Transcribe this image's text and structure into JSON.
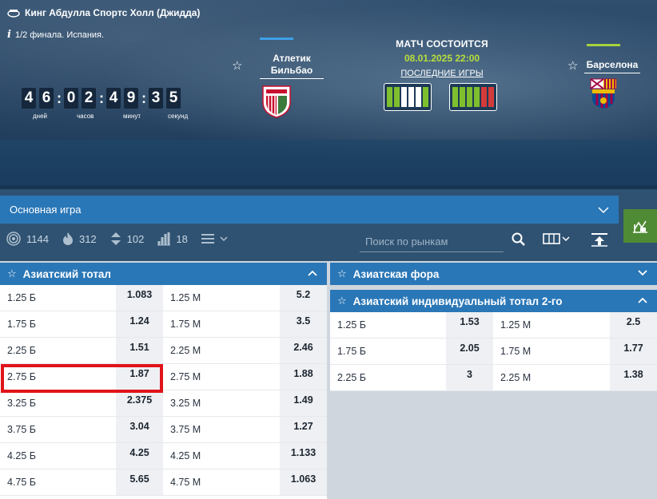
{
  "hero": {
    "venue": "Кинг Абдулла Спортс Холл (Джидда)",
    "stage": "1/2 финала. Испания.",
    "timer": {
      "digits": [
        "4",
        "6",
        "0",
        "2",
        "4",
        "9",
        "3",
        "5"
      ],
      "labels": [
        "дней",
        "часов",
        "минут",
        "секунд"
      ]
    },
    "team1": {
      "name": "Атлетик Бильбао",
      "color": "#3ea0e8",
      "form": [
        "#7fbf2e",
        "#7fbf2e",
        "#ffffff",
        "#ffffff",
        "#ffffff",
        "#7fbf2e"
      ]
    },
    "team2": {
      "name": "Барселона",
      "color": "#a6d23c",
      "form": [
        "#7fbf2e",
        "#7fbf2e",
        "#7fbf2e",
        "#7fbf2e",
        "#d33b3b",
        "#d33b3b"
      ]
    },
    "status": "МАТЧ СОСТОИТСЯ",
    "datetime": "08.01.2025 22:00",
    "last_games": "ПОСЛЕДНИЕ ИГРЫ"
  },
  "toolbar": {
    "main_game": "Основная игра",
    "stats": [
      "1144",
      "312",
      "102",
      "18"
    ],
    "search_placeholder": "Поиск по рынкам"
  },
  "left_market": {
    "title": "Азиатский тотал",
    "rows": [
      {
        "over": "1.25 Б",
        "over_odd": "1.083",
        "under": "1.25 М",
        "under_odd": "5.2"
      },
      {
        "over": "1.75 Б",
        "over_odd": "1.24",
        "under": "1.75 М",
        "under_odd": "3.5"
      },
      {
        "over": "2.25 Б",
        "over_odd": "1.51",
        "under": "2.25 М",
        "under_odd": "2.46"
      },
      {
        "over": "2.75 Б",
        "over_odd": "1.87",
        "under": "2.75 М",
        "under_odd": "1.88"
      },
      {
        "over": "3.25 Б",
        "over_odd": "2.375",
        "under": "3.25 М",
        "under_odd": "1.49"
      },
      {
        "over": "3.75 Б",
        "over_odd": "3.04",
        "under": "3.75 М",
        "under_odd": "1.27"
      },
      {
        "over": "4.25 Б",
        "over_odd": "4.25",
        "under": "4.25 М",
        "under_odd": "1.133"
      },
      {
        "over": "4.75 Б",
        "over_odd": "5.65",
        "under": "4.75 М",
        "under_odd": "1.063"
      }
    ]
  },
  "right_markets": {
    "handicap_title": "Азиатская фора",
    "ind_total_title": "Азиатский индивидуальный тотал 2-го",
    "rows": [
      {
        "over": "1.25 Б",
        "over_odd": "1.53",
        "under": "1.25 М",
        "under_odd": "2.5"
      },
      {
        "over": "1.75 Б",
        "over_odd": "2.05",
        "under": "1.75 М",
        "under_odd": "1.77"
      },
      {
        "over": "2.25 Б",
        "over_odd": "3",
        "under": "2.25 М",
        "under_odd": "1.38"
      }
    ]
  }
}
